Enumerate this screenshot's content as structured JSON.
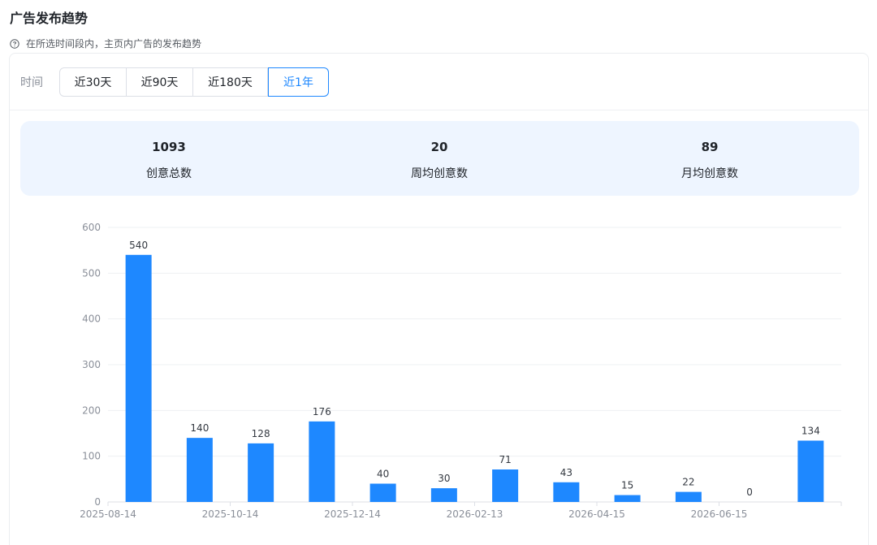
{
  "header": {
    "title": "广告发布趋势",
    "subtitle": "在所选时间段内，主页内广告的发布趋势"
  },
  "filter": {
    "label": "时间",
    "options": [
      "近30天",
      "近90天",
      "近180天",
      "近1年"
    ],
    "selected": "近1年"
  },
  "stats": [
    {
      "value": "1093",
      "label": "创意总数"
    },
    {
      "value": "20",
      "label": "周均创意数"
    },
    {
      "value": "89",
      "label": "月均创意数"
    }
  ],
  "colors": {
    "accent": "#1e88ff",
    "bar": "#1e88ff",
    "stats_bg": "#eef5ff"
  },
  "chart_data": {
    "type": "bar",
    "categories": [
      "2025-08-14",
      "",
      "2025-10-14",
      "",
      "2025-12-14",
      "",
      "2026-02-13",
      "",
      "2026-04-15",
      "",
      "2026-06-15",
      ""
    ],
    "values": [
      540,
      140,
      128,
      176,
      40,
      30,
      71,
      43,
      15,
      22,
      0,
      134
    ],
    "ylim": [
      0,
      600
    ],
    "yticks": [
      0,
      100,
      200,
      300,
      400,
      500,
      600
    ],
    "grid": true,
    "data_labels": true
  }
}
